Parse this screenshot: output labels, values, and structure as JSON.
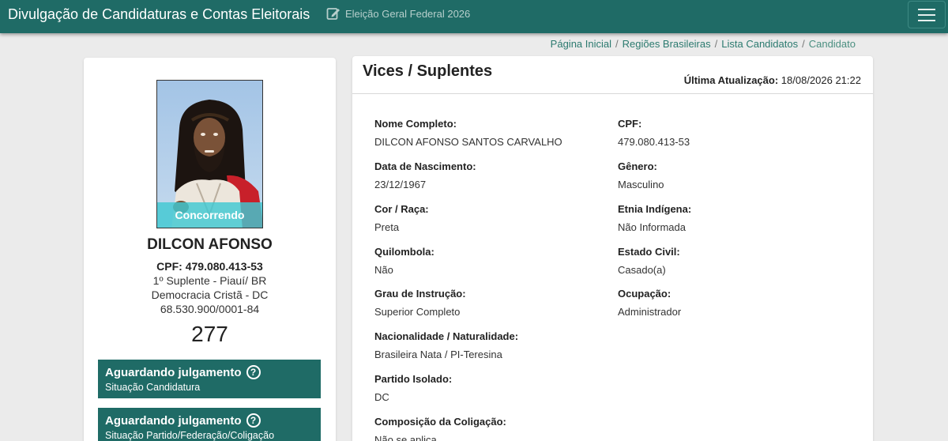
{
  "header": {
    "app_title": "Divulgação de Candidaturas e Contas Eleitorais",
    "election_label": "Eleição Geral Federal 2026",
    "bg_color": "#1f6b66"
  },
  "breadcrumb": [
    "Página Inicial",
    "Regiões Brasileiras",
    "Lista Candidatos",
    "Candidato"
  ],
  "candidate": {
    "photo_status": "Concorrendo",
    "name": "DILCON AFONSO",
    "cpf_line": "CPF: 479.080.413-53",
    "role_line": "1º Suplente - Piauí/ BR",
    "party_line": "Democracia Cristã - DC",
    "cnpj_line": "68.530.900/0001-84",
    "number": "277"
  },
  "status_boxes": [
    {
      "title": "Aguardando julgamento",
      "subtitle": "Situação Candidatura"
    },
    {
      "title": "Aguardando julgamento",
      "subtitle": "Situação Partido/Federação/Coligação"
    }
  ],
  "details": {
    "title": "Vices / Suplentes",
    "updated_label": "Última Atualização:",
    "updated_value": "18/08/2026 21:22",
    "fields": [
      {
        "label": "Nome Completo:",
        "value": "DILCON AFONSO SANTOS CARVALHO"
      },
      {
        "label": "CPF:",
        "value": "479.080.413-53"
      },
      {
        "label": "Data de Nascimento:",
        "value": "23/12/1967"
      },
      {
        "label": "Gênero:",
        "value": "Masculino"
      },
      {
        "label": "Cor / Raça:",
        "value": "Preta"
      },
      {
        "label": "Etnia Indígena:",
        "value": "Não Informada"
      },
      {
        "label": "Quilombola:",
        "value": "Não"
      },
      {
        "label": "Estado Civil:",
        "value": "Casado(a)"
      },
      {
        "label": "Grau de Instrução:",
        "value": "Superior Completo"
      },
      {
        "label": "Ocupação:",
        "value": "Administrador"
      },
      {
        "label": "Nacionalidade / Naturalidade:",
        "value": "Brasileira Nata / PI-Teresina"
      },
      {
        "label": "Partido Isolado:",
        "value": "DC"
      },
      {
        "label": "Composição da Coligação:",
        "value": "Não se aplica"
      }
    ]
  },
  "icons": {
    "election": "edit-icon",
    "menu": "hamburger-icon",
    "help": "question-circle-icon"
  }
}
